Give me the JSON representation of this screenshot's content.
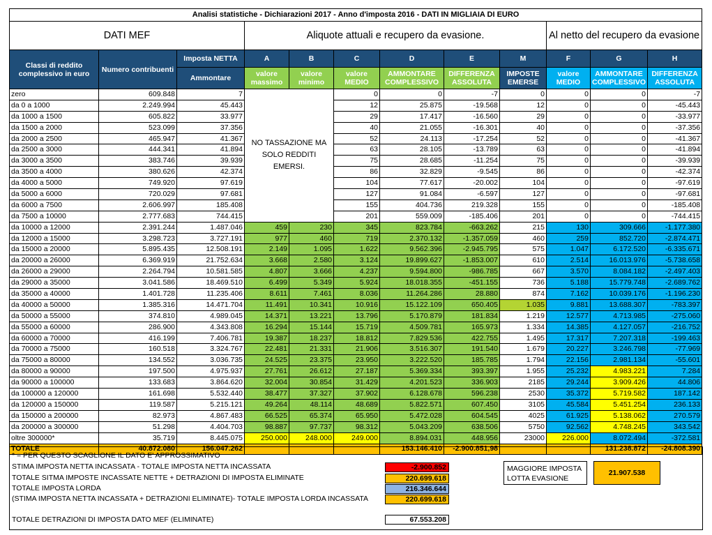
{
  "title": "Analisi statistiche - Dichiarazioni 2017 - Anno d'imposta 2016 - DATI IN MIGLIAIA DI EURO",
  "sections": {
    "mef": "DATI MEF",
    "aliquote": "Aliquote  attuali e recupero da evasione.",
    "netto": "Al netto del recupero da evasione"
  },
  "headers": {
    "classi": "Classi di reddito complessivo in euro",
    "numero": "Numero contribuenti",
    "imposta_netta": "Imposta NETTA",
    "ammontare": "Ammontare",
    "A": "A",
    "B": "B",
    "C": "C",
    "D": "D",
    "E": "E",
    "M": "M",
    "F": "F",
    "G": "G",
    "H": "H",
    "valore_massimo": "valore massimo",
    "valore_minimo": "valore minimo",
    "valore_medio": "valore MEDIO",
    "ammontare_complessivo": "AMMONTARE COMPLESSIVO",
    "differenza_assoluta": "DIFFERENZA ASSOLUTA",
    "imposte_emerse": "IMPOSTE EMERSE",
    "valore_medio_f": "valore MEDIO",
    "ammontare_complessivo_g": "AMMONTARE COMPLESSIVO",
    "differenza_assoluta_h": "DIFFERENZA ASSOLUTA"
  },
  "no_tassazione": "NO TASSAZIONE MA SOLO REDDITI EMERSI.",
  "rows": [
    [
      "zero",
      "609.848",
      "7",
      "",
      "",
      "0",
      "0",
      "-7",
      "0",
      "0",
      "0",
      "-7"
    ],
    [
      "da 0 a 1000",
      "2.249.994",
      "45.443",
      "",
      "",
      "12",
      "25.875",
      "-19.568",
      "12",
      "0",
      "0",
      "-45.443"
    ],
    [
      "da 1000 a 1500",
      "605.822",
      "33.977",
      "",
      "",
      "29",
      "17.417",
      "-16.560",
      "29",
      "0",
      "0",
      "-33.977"
    ],
    [
      "da 1500 a 2000",
      "523.099",
      "37.356",
      "",
      "",
      "40",
      "21.055",
      "-16.301",
      "40",
      "0",
      "0",
      "-37.356"
    ],
    [
      "da 2000 a 2500",
      "465.947",
      "41.367",
      "",
      "",
      "52",
      "24.113",
      "-17.254",
      "52",
      "0",
      "0",
      "-41.367"
    ],
    [
      "da 2500 a 3000",
      "444.341",
      "41.894",
      "",
      "",
      "63",
      "28.105",
      "-13.789",
      "63",
      "0",
      "0",
      "-41.894"
    ],
    [
      "da 3000 a 3500",
      "383.746",
      "39.939",
      "",
      "",
      "75",
      "28.685",
      "-11.254",
      "75",
      "0",
      "0",
      "-39.939"
    ],
    [
      "da 3500 a 4000",
      "380.626",
      "42.374",
      "",
      "",
      "86",
      "32.829",
      "-9.545",
      "86",
      "0",
      "0",
      "-42.374"
    ],
    [
      "da 4000 a 5000",
      "749.920",
      "97.619",
      "",
      "",
      "104",
      "77.617",
      "-20.002",
      "104",
      "0",
      "0",
      "-97.619"
    ],
    [
      "da 5000 a 6000",
      "720.029",
      "97.681",
      "",
      "",
      "127",
      "91.084",
      "-6.597",
      "127",
      "0",
      "0",
      "-97.681"
    ],
    [
      "da 6000 a 7500",
      "2.606.997",
      "185.408",
      "",
      "",
      "155",
      "404.736",
      "219.328",
      "155",
      "0",
      "0",
      "-185.408"
    ],
    [
      "da 7500 a 10000",
      "2.777.683",
      "744.415",
      "",
      "",
      "201",
      "559.009",
      "-185.406",
      "201",
      "0",
      "0",
      "-744.415"
    ],
    [
      "da 10000 a 12000",
      "2.391.244",
      "1.487.046",
      "459",
      "230",
      "345",
      "823.784",
      "-663.262",
      "215",
      "130",
      "309.666",
      "-1.177.380"
    ],
    [
      "da 12000 a 15000",
      "3.298.723",
      "3.727.191",
      "977",
      "460",
      "719",
      "2.370.132",
      "-1.357.059",
      "460",
      "259",
      "852.720",
      "-2.874.471"
    ],
    [
      "da 15000 a 20000",
      "5.895.435",
      "12.508.191",
      "2.149",
      "1.095",
      "1.622",
      "9.562.396",
      "-2.945.795",
      "575",
      "1.047",
      "6.172.520",
      "-6.335.671"
    ],
    [
      "da 20000 a 26000",
      "6.369.919",
      "21.752.634",
      "3.668",
      "2.580",
      "3.124",
      "19.899.627",
      "-1.853.007",
      "610",
      "2.514",
      "16.013.976",
      "-5.738.658"
    ],
    [
      "da 26000 a 29000",
      "2.264.794",
      "10.581.585",
      "4.807",
      "3.666",
      "4.237",
      "9.594.800",
      "-986.785",
      "667",
      "3.570",
      "8.084.182",
      "-2.497.403"
    ],
    [
      "da 29000 a 35000",
      "3.041.586",
      "18.469.510",
      "6.499",
      "5.349",
      "5.924",
      "18.018.355",
      "-451.155",
      "736",
      "5.188",
      "15.779.748",
      "-2.689.762"
    ],
    [
      "da 35000 a 40000",
      "1.401.728",
      "11.235.406",
      "8.611",
      "7.461",
      "8.036",
      "11.264.286",
      "28.880",
      "874",
      "7.162",
      "10.039.176",
      "-1.196.230"
    ],
    [
      "da 40000 a 50000",
      "1.385.316",
      "14.471.704",
      "11.491",
      "10.341",
      "10.916",
      "15.122.109",
      "650.405",
      "1.035",
      "9.881",
      "13.688.307",
      "-783.397"
    ],
    [
      "da 50000 a 55000",
      "374.810",
      "4.989.045",
      "14.371",
      "13.221",
      "13.796",
      "5.170.879",
      "181.834",
      "1.219",
      "12.577",
      "4.713.985",
      "-275.060"
    ],
    [
      "da 55000 a 60000",
      "286.900",
      "4.343.808",
      "16.294",
      "15.144",
      "15.719",
      "4.509.781",
      "165.973",
      "1.334",
      "14.385",
      "4.127.057",
      "-216.752"
    ],
    [
      "da 60000 a 70000",
      "416.199",
      "7.406.781",
      "19.387",
      "18.237",
      "18.812",
      "7.829.536",
      "422.755",
      "1.495",
      "17.317",
      "7.207.318",
      "-199.463"
    ],
    [
      "da 70000 a 75000",
      "160.518",
      "3.324.767",
      "22.481",
      "21.331",
      "21.906",
      "3.516.307",
      "191.540",
      "1.679",
      "20.227",
      "3.246.798",
      "-77.969"
    ],
    [
      "da 75000 a 80000",
      "134.552",
      "3.036.735",
      "24.525",
      "23.375",
      "23.950",
      "3.222.520",
      "185.785",
      "1.794",
      "22.156",
      "2.981.134",
      "-55.601"
    ],
    [
      "da 80000 a 90000",
      "197.500",
      "4.975.937",
      "27.761",
      "26.612",
      "27.187",
      "5.369.334",
      "393.397",
      "1.955",
      "25.232",
      "4.983.221",
      "7.284"
    ],
    [
      "da 90000 a 100000",
      "133.683",
      "3.864.620",
      "32.004",
      "30.854",
      "31.429",
      "4.201.523",
      "336.903",
      "2185",
      "29.244",
      "3.909.426",
      "44.806"
    ],
    [
      "da 100000 a 120000",
      "161.698",
      "5.532.440",
      "38.477",
      "37.327",
      "37.902",
      "6.128.678",
      "596.238",
      "2530",
      "35.372",
      "5.719.582",
      "187.142"
    ],
    [
      "da 120000 a 150000",
      "119.587",
      "5.215.121",
      "49.264",
      "48.114",
      "48.689",
      "5.822.571",
      "607.450",
      "3105",
      "45.584",
      "5.451.254",
      "236.133"
    ],
    [
      "da 150000 a 200000",
      "82.973",
      "4.867.483",
      "66.525",
      "65.374",
      "65.950",
      "5.472.028",
      "604.545",
      "4025",
      "61.925",
      "5.138.062",
      "270.579"
    ],
    [
      "da 200000 a 300000",
      "51.298",
      "4.404.703",
      "98.887",
      "97.737",
      "98.312",
      "5.043.209",
      "638.506",
      "5750",
      "92.562",
      "4.748.245",
      "343.542"
    ],
    [
      "oltre 300000*",
      "35.719",
      "8.445.075",
      "250.000",
      "248.000",
      "249.000",
      "8.894.031",
      "448.956",
      "23000",
      "226.000",
      "8.072.494",
      "-372.581"
    ]
  ],
  "totale": [
    "TOTALE",
    "40.872.080",
    "156.047.262",
    "",
    "",
    "",
    "153.146.410",
    "-2.900.851,98",
    "",
    "",
    "131.238.872",
    "-24.808.390"
  ],
  "footer": {
    "note": "* = PER QUESTO SCAGLIONE IL DATO E' APPROSSIMATIVO",
    "line1": "STIMA IMPOSTA NETTA INCASSATA - TOTALE IMPOSTA NETTA INCASSATA",
    "val1": "-2.900.852",
    "line2": "TOTALE SITMA IMPOSTE INCASSATE NETTE  + DETRAZIONI DI IMPOSTA ELIMINATE",
    "val2": "220.699.618",
    "line3": "TOTALE IMPOSTA LORDA",
    "val3": "216.346.644",
    "line4": "(STIMA IMPOSTA NETTA INCASSATA + DETRAZIONI ELIMINATE)- TOTALE IMPOSTA LORDA INCASSATA",
    "val4": "220.699.618",
    "line5": "TOTALE DETRAZIONI DI IMPOSTA DATO MEF (ELIMINATE)",
    "val5": "67.553.208",
    "maggiore_label": "MAGGIORE IMPOSTA LOTTA EVASIONE",
    "maggiore_val": "21.907.538"
  },
  "colors": {
    "header_navy": "#1f4e79",
    "green": "#92d050",
    "cyan": "#00b0f0",
    "yellow": "#ffff00",
    "orange": "#ffc000",
    "red": "#ff0000",
    "light_blue": "#8eb4e3"
  }
}
